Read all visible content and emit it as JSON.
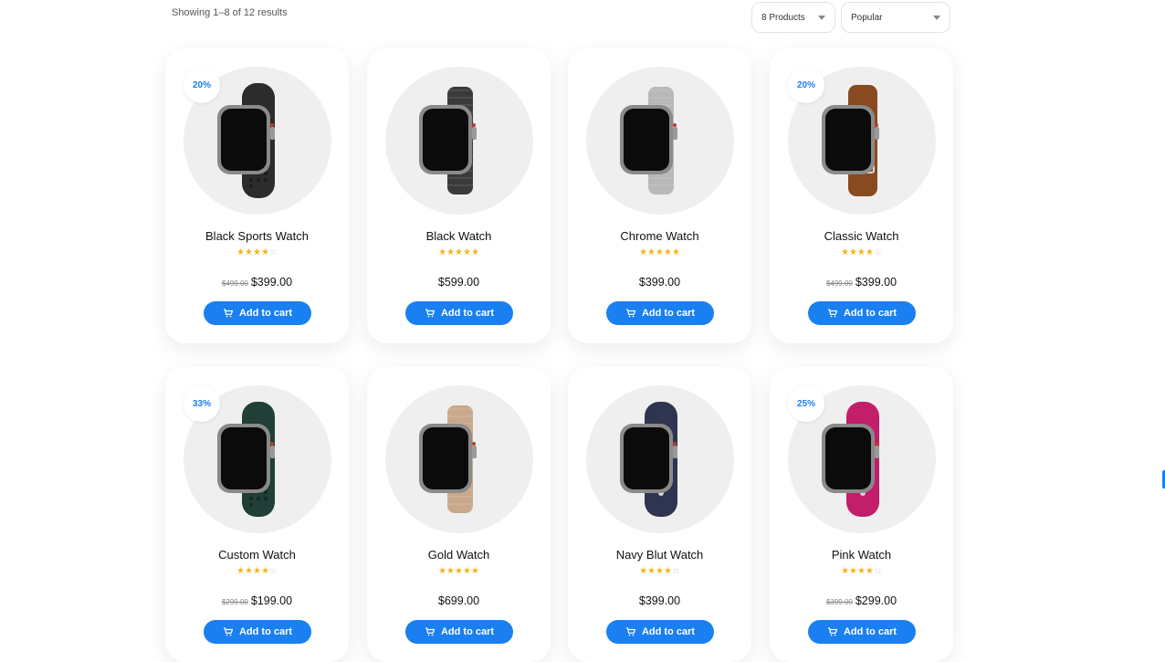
{
  "header": {
    "results_text": "Showing 1–8 of 12 results",
    "per_page_select": "8 Products",
    "sort_select": "Popular"
  },
  "products": [
    {
      "name": "Black Sports Watch",
      "badge": "20%",
      "rating": 4,
      "old_price": "$499.00",
      "price": "$399.00",
      "cart_label": "Add to cart",
      "band_color": "#2c2c2c",
      "band_type": "sport"
    },
    {
      "name": "Black Watch",
      "badge": "",
      "rating": 5,
      "old_price": "",
      "price": "$599.00",
      "cart_label": "Add to cart",
      "band_color": "#3a3a3a",
      "band_type": "mesh"
    },
    {
      "name": "Chrome Watch",
      "badge": "",
      "rating": 5,
      "old_price": "",
      "price": "$399.00",
      "cart_label": "Add to cart",
      "band_color": "#b8b8b8",
      "band_type": "mesh"
    },
    {
      "name": "Classic Watch",
      "badge": "20%",
      "rating": 4,
      "old_price": "$499.00",
      "price": "$399.00",
      "cart_label": "Add to cart",
      "band_color": "#8a4a20",
      "band_type": "leather"
    },
    {
      "name": "Custom Watch",
      "badge": "33%",
      "rating": 4,
      "old_price": "$299.00",
      "price": "$199.00",
      "cart_label": "Add to cart",
      "band_color": "#1f3f37",
      "band_type": "sport"
    },
    {
      "name": "Gold Watch",
      "badge": "",
      "rating": 5,
      "old_price": "",
      "price": "$699.00",
      "cart_label": "Add to cart",
      "band_color": "#c9a98b",
      "band_type": "mesh"
    },
    {
      "name": "Navy Blut Watch",
      "badge": "",
      "rating": 4,
      "old_price": "",
      "price": "$399.00",
      "cart_label": "Add to cart",
      "band_color": "#2f3550",
      "band_type": "solo"
    },
    {
      "name": "Pink Watch",
      "badge": "25%",
      "rating": 4,
      "old_price": "$399.00",
      "price": "$299.00",
      "cart_label": "Add to cart",
      "band_color": "#c21e6a",
      "band_type": "solo"
    }
  ],
  "colors": {
    "accent": "#1a7ff0",
    "star": "#f3b51a"
  },
  "icons": {
    "cart": "cart-icon",
    "caret": "chevron-down-icon"
  }
}
